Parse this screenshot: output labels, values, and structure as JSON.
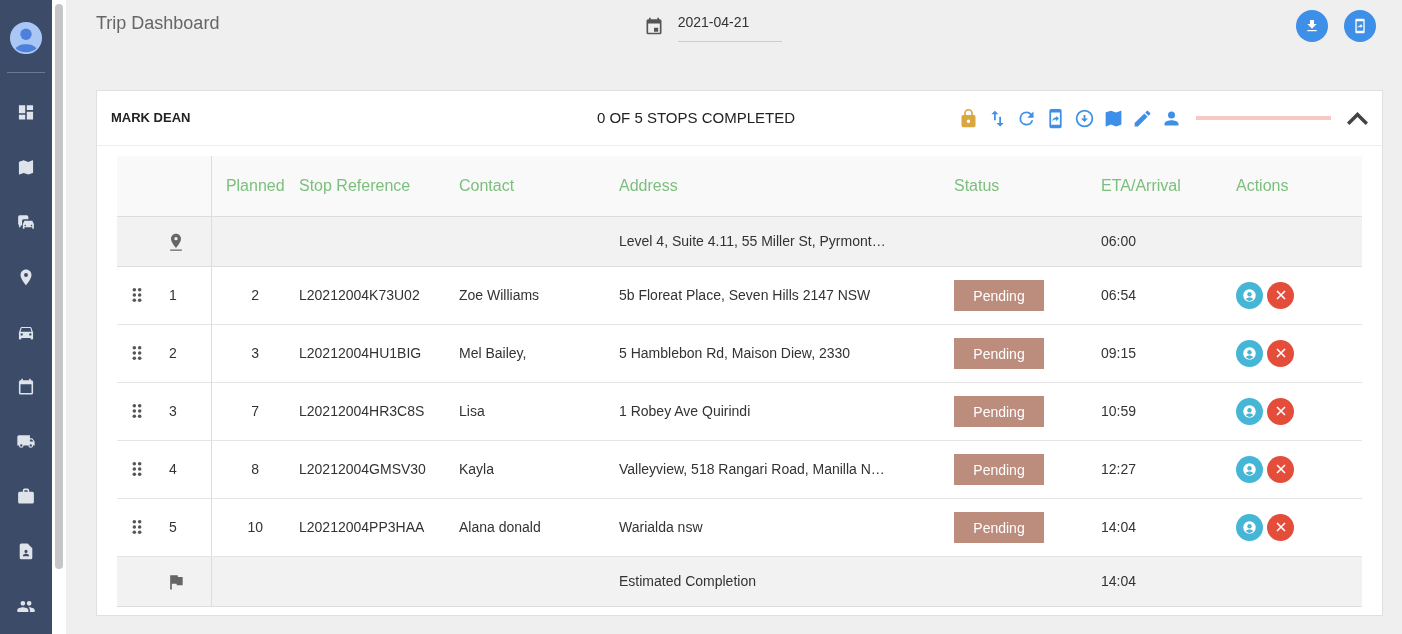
{
  "page": {
    "title": "Trip Dashboard",
    "date": "2021-04-21"
  },
  "trip": {
    "driver": "MARK DEAN",
    "summary": "0 OF 5 STOPS COMPLETED",
    "expanded": true
  },
  "table": {
    "columns": [
      "Planned",
      "Stop Reference",
      "Contact",
      "Address",
      "Status",
      "ETA/Arrival",
      "Actions"
    ],
    "rows": [
      {
        "kind": "start",
        "address": "Level 4, Suite 4.11, 55 Miller St, Pyrmont…",
        "eta": "06:00"
      },
      {
        "kind": "stop",
        "index": "1",
        "planned": "2",
        "reference": "L20212004K73U02",
        "contact": "Zoe Williams",
        "address": "5b Floreat Place, Seven Hills 2147 NSW",
        "status": "Pending",
        "eta": "06:54"
      },
      {
        "kind": "stop",
        "index": "2",
        "planned": "3",
        "reference": "L20212004HU1BIG",
        "contact": "Mel Bailey,",
        "address": "5 Hamblebon Rd, Maison Diew, 2330",
        "status": "Pending",
        "eta": "09:15"
      },
      {
        "kind": "stop",
        "index": "3",
        "planned": "7",
        "reference": "L20212004HR3C8S",
        "contact": "Lisa",
        "address": "1 Robey Ave Quirindi",
        "status": "Pending",
        "eta": "10:59"
      },
      {
        "kind": "stop",
        "index": "4",
        "planned": "8",
        "reference": "L20212004GMSV30",
        "contact": "Kayla",
        "address": "Valleyview, 518 Rangari Road, Manilla N…",
        "status": "Pending",
        "eta": "12:27"
      },
      {
        "kind": "stop",
        "index": "5",
        "planned": "10",
        "reference": "L20212004PP3HAA",
        "contact": "Alana donald",
        "address": "Warialda nsw",
        "status": "Pending",
        "eta": "14:04"
      },
      {
        "kind": "end",
        "address": "Estimated Completion",
        "eta": "14:04"
      }
    ]
  }
}
